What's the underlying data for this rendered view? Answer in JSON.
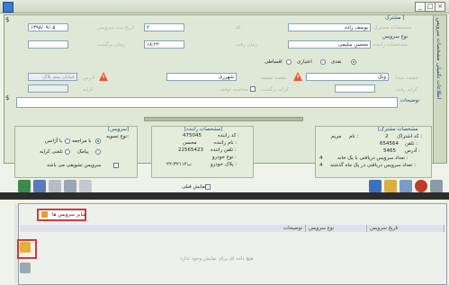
{
  "window": {
    "min": "_",
    "max": "□",
    "close": "×"
  },
  "side_tabs": [
    "مشخصات سرویس",
    "اطلاعات تکمیلی"
  ],
  "customer": {
    "header": "مشترک ]",
    "label": "مشخصات مشترک",
    "name_value": "یوسف زاده",
    "code_label": "کد",
    "code_value": "۲",
    "issue_date_label": "تاریخ ثبت سرویس",
    "issue_date_value": "۱۳۹۸/۰۹/۰۵"
  },
  "service": {
    "header": "نوع سرویس",
    "label": "مشخصات راننده",
    "driver_value": "محسن سلیمی",
    "time_label": "زمان رفت",
    "time_value": "۱۸:۲۲",
    "return_label": "زمان برگشت",
    "pay_options": [
      "نقدی",
      "اعتباری",
      "اقساطی"
    ],
    "pay_selected": 0,
    "origin_label": "مقصد مبدا",
    "origin_value": "ونک",
    "dest_label": "مقصد مقصد",
    "dest_value": "شهرری",
    "address_label": "آدرس",
    "address_hint": "خیابان بیتم پلاک",
    "fare_label": "کرایه رفت",
    "return_fare_label": "کرایه برگشت",
    "extra_label": "کرایه",
    "round_trip_label": "محاسبه توقف",
    "notes_label": "توضیحات"
  },
  "info_customer": {
    "header": "[مشخصات مشترک",
    "rows": [
      {
        "label": "کد اشتراک :",
        "value": "2"
      },
      {
        "label": "تلفن :",
        "value": "654564"
      },
      {
        "label": "آدرس :",
        "value": "5465"
      }
    ],
    "name_label": "نام :",
    "name_value": "مریم",
    "count1_label": "تعداد سرویس دریافتی با یک خانه :",
    "count1_value": "4",
    "count2_label": "تعداد سرویس دریافتی در یک ماه گذشته :",
    "count2_value": "4"
  },
  "info_driver": {
    "header": "[مشخصات راننده]",
    "rows": [
      {
        "label": "کد راننده :",
        "value": "475045"
      },
      {
        "label": "نام راننده :",
        "value": "محسن"
      },
      {
        "label": "تلفن راننده :",
        "value": "22565423"
      },
      {
        "label": "نوع خودرو :",
        "value": ""
      },
      {
        "label": "پلاک خودرو :",
        "value": "۲۲-۳۲۱ب۱۲"
      }
    ]
  },
  "info_service": {
    "header": "[سرویس]",
    "type_label": "نوع تسویه:",
    "opts": [
      "با مراجعه",
      "با آژانس",
      "پیامک",
      "تلفنی کرایه"
    ],
    "checkbox_label": "سرویس تشویقی می باشد"
  },
  "show_unread": "نمایش قبلی",
  "lower": {
    "tab_label": "سایر سرویس ها",
    "columns": [
      "توضیحات",
      "نوع سرویس",
      "تاریخ سرویس"
    ],
    "empty_text": "هیچ داده ای برای نمایش وجود ندارد"
  }
}
